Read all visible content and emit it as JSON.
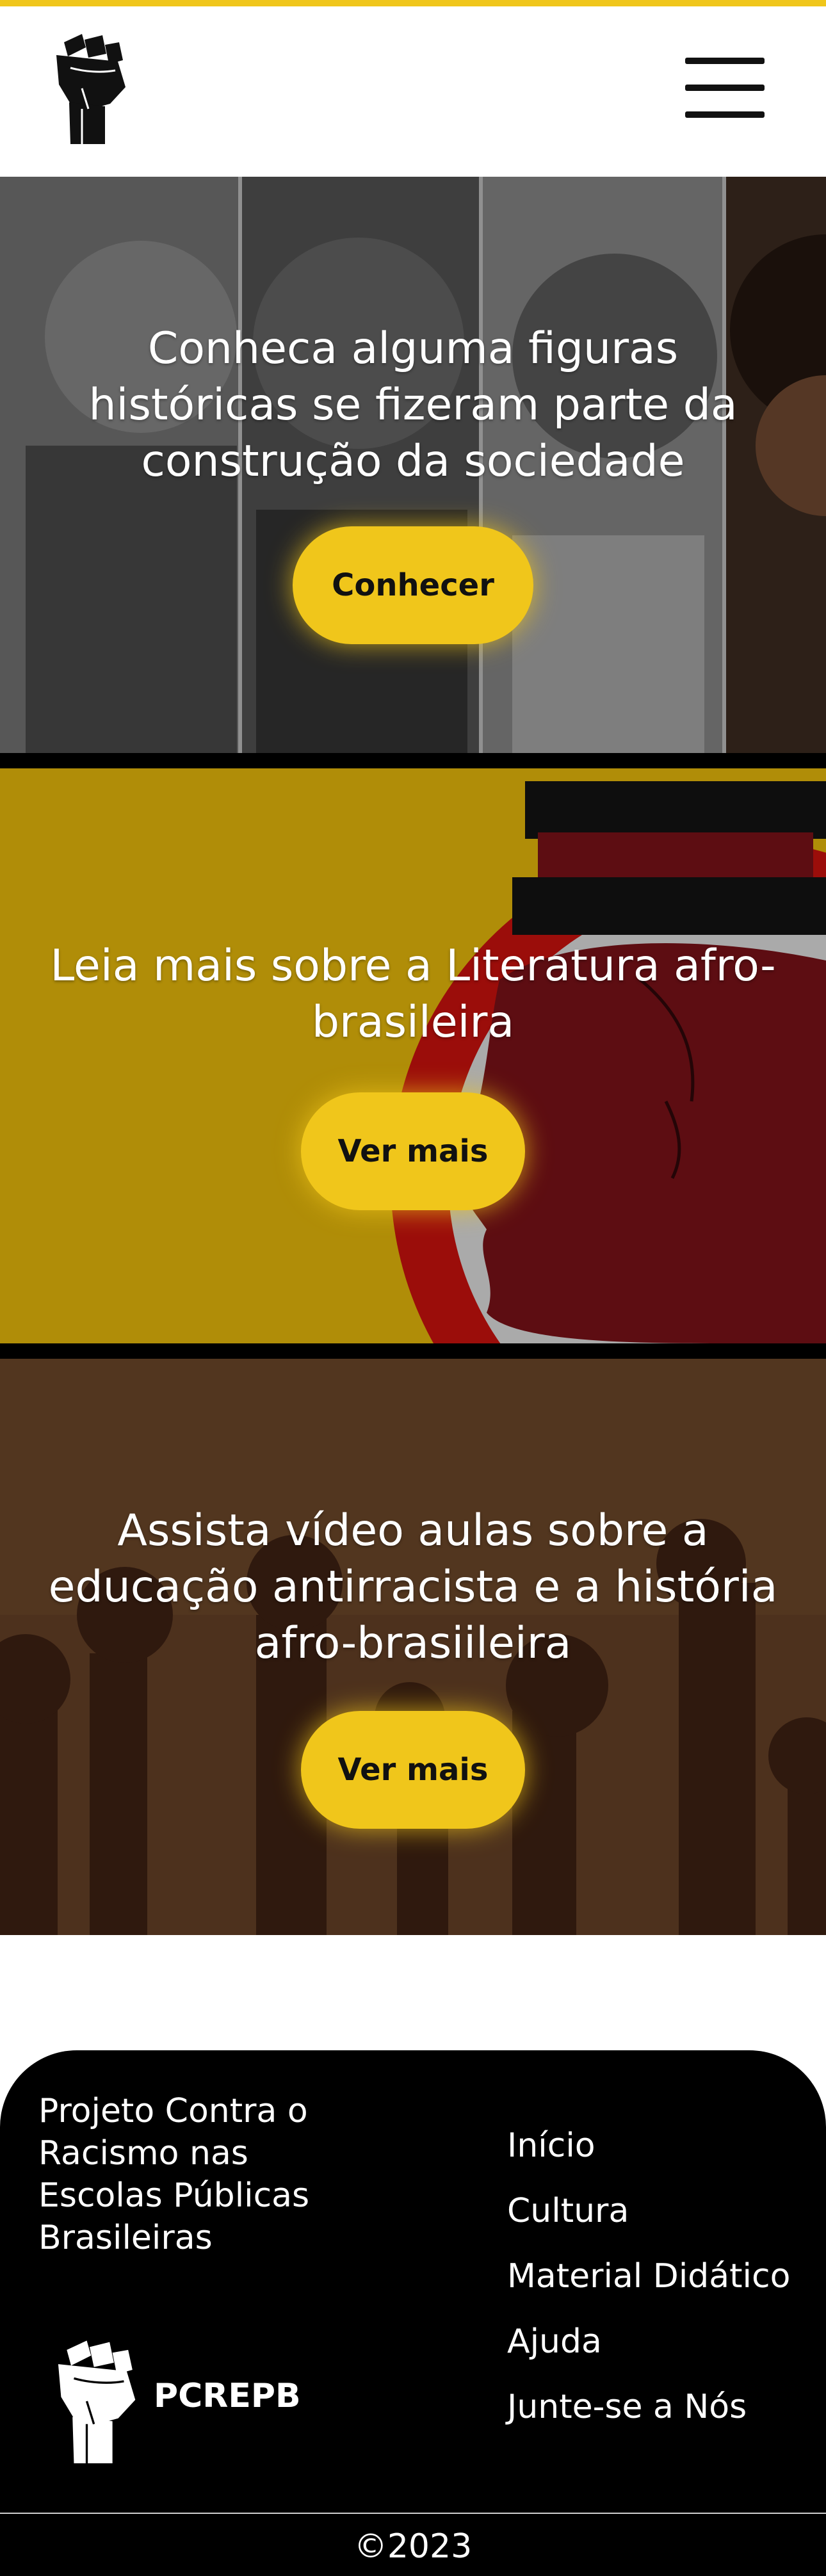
{
  "colors": {
    "accent": "#f0c61b",
    "footer_bg": "#000000",
    "text_light": "#ffffff"
  },
  "header": {
    "logo_icon": "raised-fist-icon",
    "menu_icon": "hamburger-menu-icon"
  },
  "sections": [
    {
      "text": "Conheca alguma figuras históricas se fizeram parte da construção da sociedade",
      "button": "Conhecer"
    },
    {
      "text": "Leia mais sobre a Literatura afro-brasileira",
      "button": "Ver mais"
    },
    {
      "text": "Assista vídeo aulas sobre a educação antirracista e a história afro-brasiileira",
      "button": "Ver mais"
    }
  ],
  "footer": {
    "project": "Projeto Contra o Racismo nas Escolas Públicas Brasileiras",
    "brand_icon": "raised-fist-icon",
    "brand": "PCREPB",
    "links": [
      "Início",
      "Cultura",
      "Material Didático",
      "Ajuda",
      "Junte-se a Nós"
    ],
    "copyright": "©2023"
  }
}
